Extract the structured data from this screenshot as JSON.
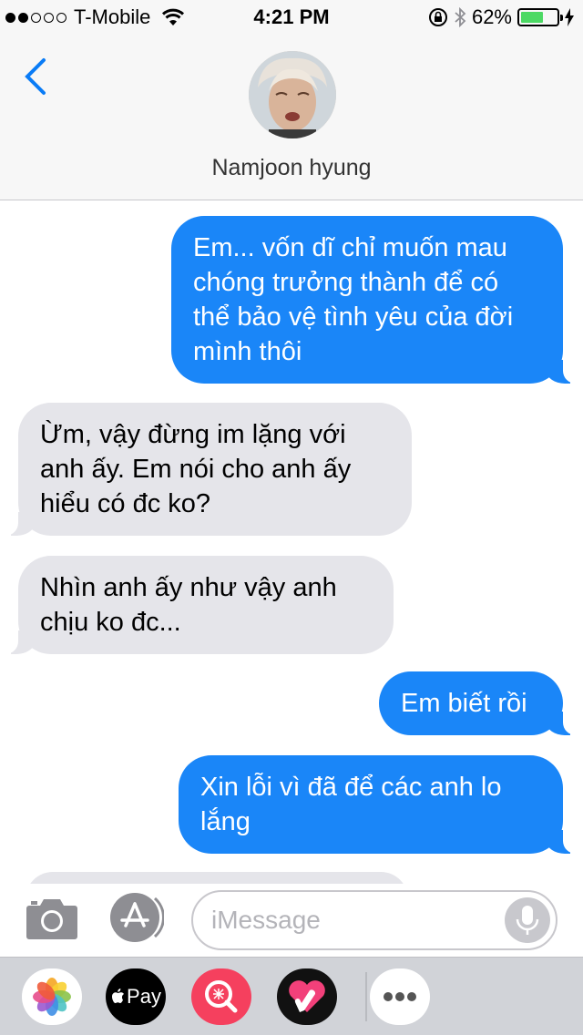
{
  "status_bar": {
    "carrier": "T-Mobile",
    "signal_bars_filled": 2,
    "signal_bars_total": 5,
    "time": "4:21 PM",
    "battery_percent": "62%",
    "battery_level": 0.62
  },
  "header": {
    "contact_name": "Namjoon hyung"
  },
  "messages": [
    {
      "direction": "sent",
      "text": "Em... vốn dĩ chỉ muốn mau chóng trưởng thành để có thể bảo vệ tình yêu của đời mình thôi"
    },
    {
      "direction": "received",
      "text": "Ừm, vậy đừng im lặng với anh ấy. Em nói cho anh ấy hiểu có đc ko?"
    },
    {
      "direction": "received",
      "text": "Nhìn anh ấy như vậy anh chịu ko đc..."
    },
    {
      "direction": "sent",
      "text": "Em biết rồi"
    },
    {
      "direction": "sent",
      "text": "Xin lỗi vì đã để các anh lo lắng"
    }
  ],
  "input_bar": {
    "placeholder": "iMessage"
  },
  "app_drawer": {
    "apple_pay_label": "Pay",
    "apps": [
      "photos-icon",
      "apple-pay-icon",
      "image-search-icon",
      "digital-touch-icon",
      "more-icon"
    ]
  },
  "colors": {
    "sent_bubble": "#1a86f8",
    "received_bubble": "#e5e5ea",
    "accent": "#0a7cf6",
    "battery": "#4cd964"
  }
}
